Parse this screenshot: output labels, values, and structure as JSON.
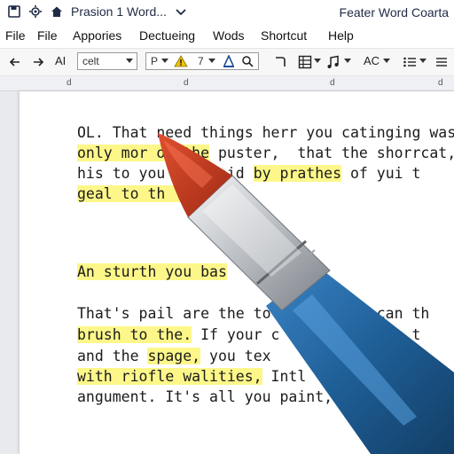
{
  "titlebar": {
    "doc_title": "Prasion 1 Word...",
    "right_title": "Feater Word Coarta"
  },
  "menu": [
    "File",
    "File",
    "Appories",
    "Dectueing",
    "Wods",
    "Shortcut",
    "Help"
  ],
  "toolbar": {
    "ai_label": "AI",
    "font_name": "celt",
    "style_label": "P",
    "size_value": "7",
    "ac_label": "AC"
  },
  "ruler": {
    "marks": [
      "d",
      "d",
      "d",
      "d"
    ]
  },
  "document": {
    "lines": [
      {
        "segments": [
          {
            "text": "OL. That need things herr you catinging was a",
            "hl": false
          }
        ]
      },
      {
        "segments": [
          {
            "text": "only mor of the",
            "hl": true
          },
          {
            "text": " puster,  that the shorrcat,",
            "hl": false
          }
        ]
      },
      {
        "segments": [
          {
            "text": "his to you ms, haid ",
            "hl": false
          },
          {
            "text": "by prathes",
            "hl": true
          },
          {
            "text": " of yui t",
            "hl": false
          }
        ]
      },
      {
        "segments": [
          {
            "text": "geal to th    rs.",
            "hl": true
          }
        ]
      },
      {
        "segments": [
          {
            "text": "An sturth you bas",
            "hl": true
          }
        ]
      },
      {
        "segments": [
          {
            "text": "That's pail are the to        ary can th",
            "hl": false
          }
        ]
      },
      {
        "segments": [
          {
            "text": "brush to the.",
            "hl": true
          },
          {
            "text": " If your c       ly case t",
            "hl": false
          }
        ]
      },
      {
        "segments": [
          {
            "text": "and the ",
            "hl": false
          },
          {
            "text": "spage,",
            "hl": true
          },
          {
            "text": " you tex        ussif,",
            "hl": false
          }
        ]
      },
      {
        "segments": [
          {
            "text": "with riofle walities,",
            "hl": true
          },
          {
            "text": " Intl          derat",
            "hl": false
          }
        ]
      },
      {
        "segments": [
          {
            "text": "angument. It's all you paint,           d",
            "hl": false
          }
        ]
      }
    ]
  },
  "colors": {
    "highlight": "#fdf78a",
    "pen_body": "#1f5f97",
    "pen_tip": "#c63a1f",
    "ferrule": "#c9ccd0"
  }
}
